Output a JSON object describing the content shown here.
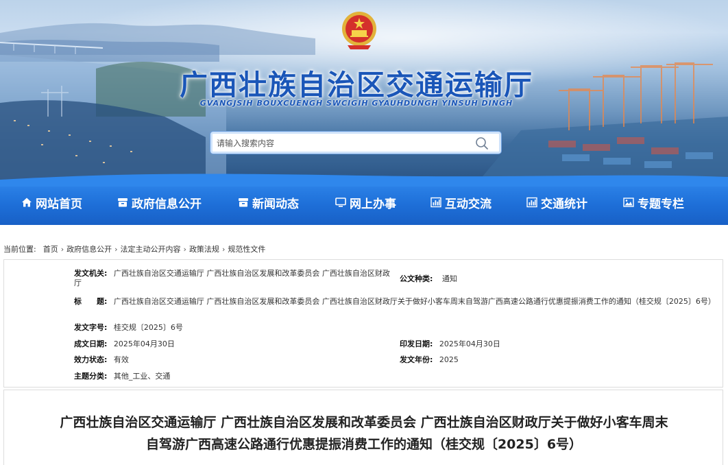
{
  "site": {
    "title": "广西壮族自治区交通运输厅",
    "subtitle": "GVANGJSIH BOUXCUENGH SWCIGIH GYAUHDUNGH YINSUH DINGH",
    "search_placeholder": "请输入搜索内容"
  },
  "nav": [
    {
      "label": "网站首页",
      "icon": "home-icon"
    },
    {
      "label": "政府信息公开",
      "icon": "archive-icon"
    },
    {
      "label": "新闻动态",
      "icon": "news-icon"
    },
    {
      "label": "网上办事",
      "icon": "monitor-icon"
    },
    {
      "label": "互动交流",
      "icon": "bar-chart-icon"
    },
    {
      "label": "交通统计",
      "icon": "bar-chart-icon"
    },
    {
      "label": "专题专栏",
      "icon": "image-icon"
    }
  ],
  "breadcrumb": {
    "prefix": "当前位置:",
    "items": [
      "首页",
      "政府信息公开",
      "法定主动公开内容",
      "政策法规",
      "规范性文件"
    ]
  },
  "info": {
    "issuer_label": "发文机关:",
    "issuer_value": "广西壮族自治区交通运输厅 广西壮族自治区发展和改革委员会 广西壮族自治区财政厅",
    "doc_type_label": "公文种类:",
    "doc_type_value": "通知",
    "title_label": "标　　题:",
    "title_value": "广西壮族自治区交通运输厅 广西壮族自治区发展和改革委员会 广西壮族自治区财政厅关于做好小客车周末自驾游广西高速公路通行优惠提振消费工作的通知（桂交规〔2025〕6号）",
    "doc_no_label": "发文字号:",
    "doc_no_value": "桂交规〔2025〕6号",
    "created_label": "成文日期:",
    "created_value": "2025年04月30日",
    "printed_label": "印发日期:",
    "printed_value": "2025年04月30日",
    "status_label": "效力状态:",
    "status_value": "有效",
    "year_label": "发文年份:",
    "year_value": "2025",
    "topic_label": "主题分类:",
    "topic_value": "其他_工业、交通"
  },
  "article": {
    "title_line1": "广西壮族自治区交通运输厅 广西壮族自治区发展和改革委员会 广西壮族自治区财政厅关于做好小客车周末",
    "title_line2": "自驾游广西高速公路通行优惠提振消费工作的通知（桂交规〔2025〕6号）"
  },
  "colors": {
    "brand_blue": "#1a56b8",
    "nav_blue": "#1e6fd8"
  }
}
